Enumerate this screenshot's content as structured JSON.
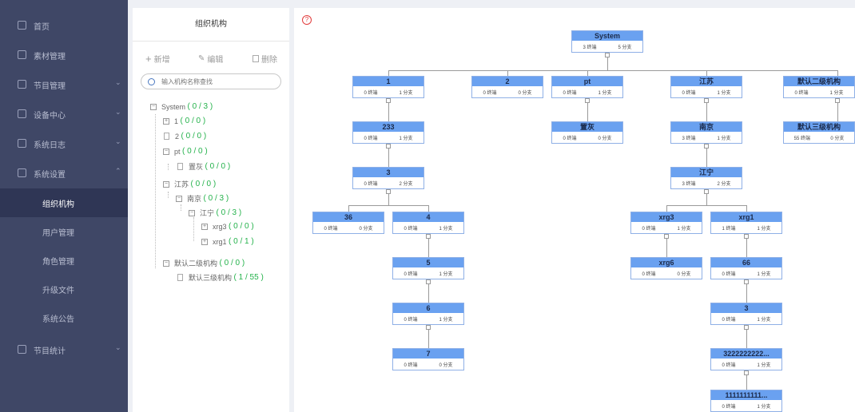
{
  "sidebar": {
    "items": [
      {
        "label": "首页",
        "icon": "grid-icon"
      },
      {
        "label": "素材管理",
        "icon": "folder-icon"
      },
      {
        "label": "节目管理",
        "icon": "layers-icon",
        "arrow": "⌄"
      },
      {
        "label": "设备中心",
        "icon": "monitor-icon",
        "arrow": "⌄"
      },
      {
        "label": "系统日志",
        "icon": "log-icon",
        "arrow": "⌄"
      },
      {
        "label": "系统设置",
        "icon": "settings-icon",
        "arrow": "⌃"
      },
      {
        "label": "节目统计",
        "icon": "chart-icon",
        "arrow": "⌄"
      }
    ],
    "subitems": [
      "组织机构",
      "用户管理",
      "角色管理",
      "升级文件",
      "系统公告"
    ],
    "active": "组织机构"
  },
  "panel": {
    "title": "组织机构",
    "add_label": "新增",
    "edit_label": "编辑",
    "delete_label": "删除",
    "search_placeholder": "输入机构名称查找"
  },
  "tree": [
    {
      "name": "System",
      "count": "( 0 / 3 )"
    },
    {
      "name": "1",
      "count": "( 0 / 0 )"
    },
    {
      "name": "2",
      "count": "( 0 / 0 )"
    },
    {
      "name": "pt",
      "count": "( 0 / 0 )"
    },
    {
      "name": "置灰",
      "count": "( 0 / 0 )"
    },
    {
      "name": "江苏",
      "count": "( 0 / 0 )"
    },
    {
      "name": "南京",
      "count": "( 0 / 3 )"
    },
    {
      "name": "江宁",
      "count": "( 0 / 3 )"
    },
    {
      "name": "xrg3",
      "count": "( 0 / 0 )"
    },
    {
      "name": "xrg1",
      "count": "( 0 / 1 )"
    },
    {
      "name": "默认二级机构",
      "count": "( 0 / 0 )"
    },
    {
      "name": "默认三级机构",
      "count": "( 1 / 55 )"
    }
  ],
  "org_chart": {
    "nodes": [
      {
        "name": "System",
        "terminals": "3 终端",
        "branches": "5 分支"
      },
      {
        "name": "1",
        "terminals": "0 终端",
        "branches": "1 分支"
      },
      {
        "name": "2",
        "terminals": "0 终端",
        "branches": "0 分支"
      },
      {
        "name": "pt",
        "terminals": "0 终端",
        "branches": "1 分支"
      },
      {
        "name": "江苏",
        "terminals": "0 终端",
        "branches": "1 分支"
      },
      {
        "name": "默认二级机构",
        "terminals": "0 终端",
        "branches": "1 分支"
      },
      {
        "name": "233",
        "terminals": "0 终端",
        "branches": "1 分支"
      },
      {
        "name": "置灰",
        "terminals": "0 终端",
        "branches": "0 分支"
      },
      {
        "name": "南京",
        "terminals": "3 终端",
        "branches": "1 分支"
      },
      {
        "name": "默认三级机构",
        "terminals": "55 终端",
        "branches": "0 分支"
      },
      {
        "name": "3",
        "terminals": "0 终端",
        "branches": "2 分支"
      },
      {
        "name": "江宁",
        "terminals": "3 终端",
        "branches": "2 分支"
      },
      {
        "name": "36",
        "terminals": "0 终端",
        "branches": "0 分支"
      },
      {
        "name": "4",
        "terminals": "0 终端",
        "branches": "1 分支"
      },
      {
        "name": "xrg3",
        "terminals": "0 终端",
        "branches": "1 分支"
      },
      {
        "name": "xrg1",
        "terminals": "1 终端",
        "branches": "1 分支"
      },
      {
        "name": "5",
        "terminals": "0 终端",
        "branches": "1 分支"
      },
      {
        "name": "xrg6",
        "terminals": "0 终端",
        "branches": "0 分支"
      },
      {
        "name": "66",
        "terminals": "0 终端",
        "branches": "1 分支"
      },
      {
        "name": "6",
        "terminals": "0 终端",
        "branches": "1 分支"
      },
      {
        "name": "3",
        "terminals": "0 终端",
        "branches": "1 分支"
      },
      {
        "name": "7",
        "terminals": "0 终端",
        "branches": "0 分支"
      },
      {
        "name": "3222222222...",
        "terminals": "0 终端",
        "branches": "1 分支"
      },
      {
        "name": "1111111111...",
        "terminals": "0 终端",
        "branches": "1 分支"
      }
    ]
  },
  "colors": {
    "sidebar_bg": "#3f4766",
    "node_header": "#6aa1f0",
    "count_green": "#24b24b"
  }
}
